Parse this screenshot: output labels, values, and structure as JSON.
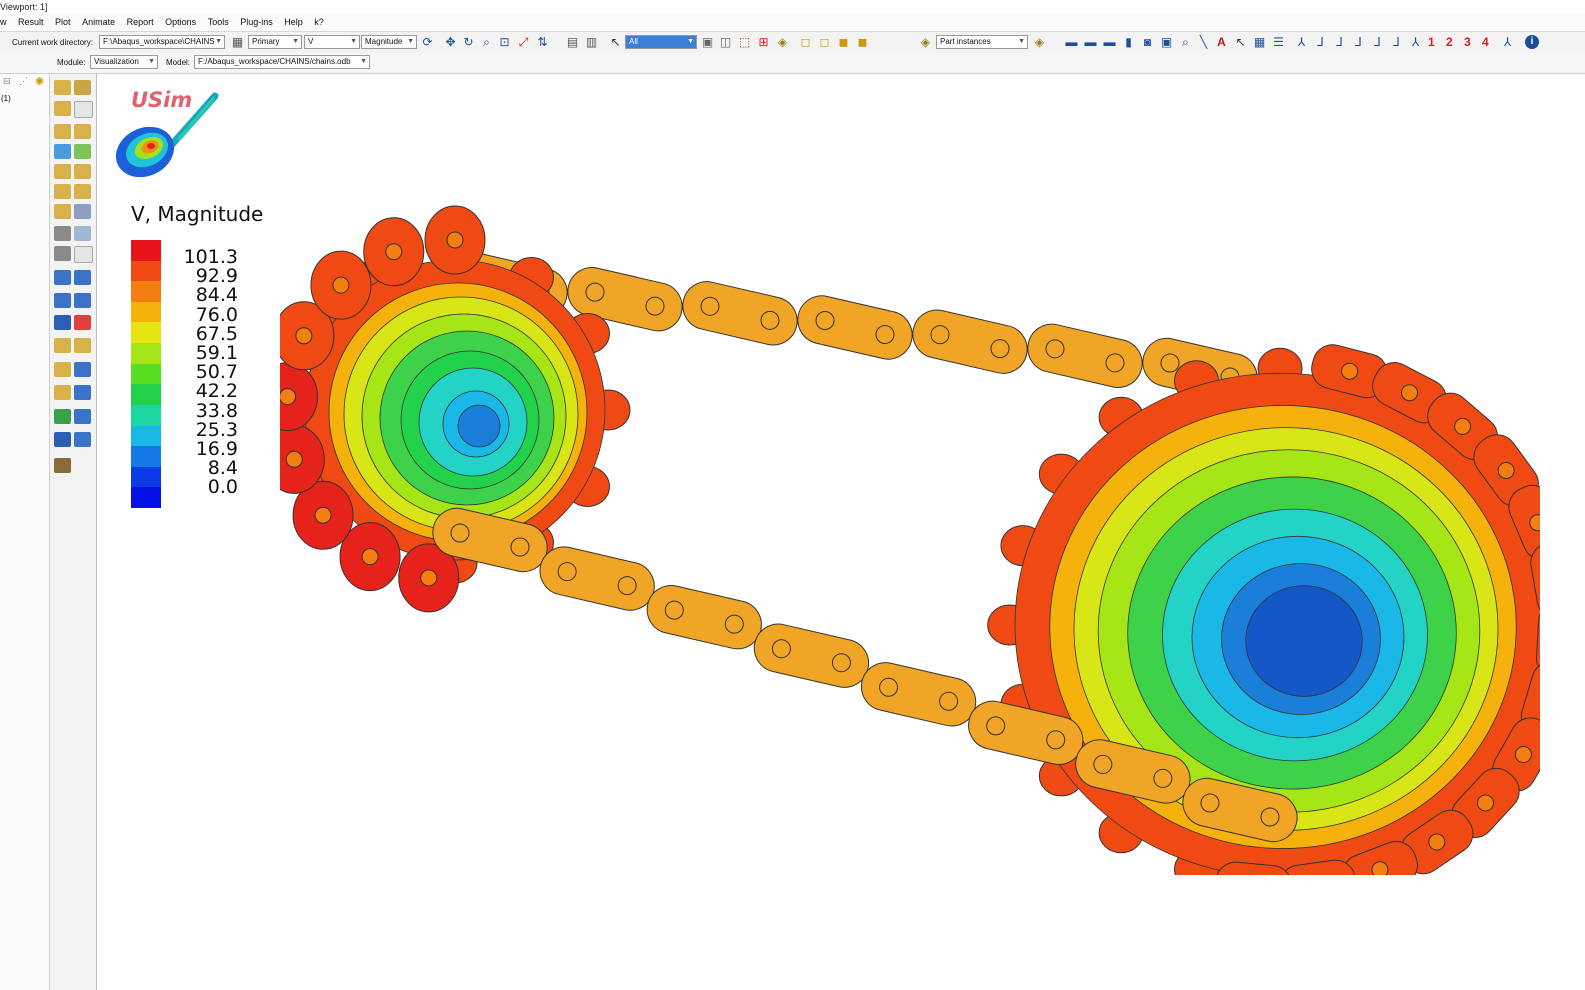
{
  "titlebar": {
    "text": "Viewport: 1]"
  },
  "menu": [
    "w",
    "Result",
    "Plot",
    "Animate",
    "Report",
    "Options",
    "Tools",
    "Plug-ins",
    "Help",
    "k?"
  ],
  "toolbar": {
    "workdir_label": "Current work directory:",
    "workdir_value": "F:\\Abaqus_workspace\\CHAINS",
    "step_label": "Primary",
    "variable": "V",
    "invariant": "Magnitude",
    "selection": "All",
    "display_group": "Part instances",
    "view_numbers": [
      "1",
      "2",
      "3",
      "4"
    ]
  },
  "module_bar": {
    "module_label": "Module:",
    "module_value": "Visualization",
    "model_label": "Model:",
    "model_value": "F:/Abaqus_workspace/CHAINS/chains.odb"
  },
  "tree": {
    "item": "(1)"
  },
  "viewport": {
    "logo_text": "USim",
    "legend": {
      "title": "V, Magnitude",
      "values": [
        "101.3",
        "92.9",
        "84.4",
        "76.0",
        "67.5",
        "59.1",
        "50.7",
        "42.2",
        "33.8",
        "25.3",
        "16.9",
        "8.4",
        "0.0"
      ],
      "colors": [
        "#e8141a",
        "#f04a14",
        "#f47f10",
        "#f5b20d",
        "#e6e413",
        "#a6e516",
        "#58dd22",
        "#23d24b",
        "#20d6a0",
        "#19b8e6",
        "#1477e6",
        "#0b3be6",
        "#0410e6"
      ]
    },
    "model_colors": {
      "link": "#f0a526",
      "link_dark": "#c7841a",
      "hot": "#ef4a14",
      "red": "#e6231a",
      "hub_green": "#3dd24a",
      "hub_yellow": "#d8e516",
      "hub_cyan": "#22d3c6",
      "hub_blue": "#1a7fd9"
    }
  }
}
